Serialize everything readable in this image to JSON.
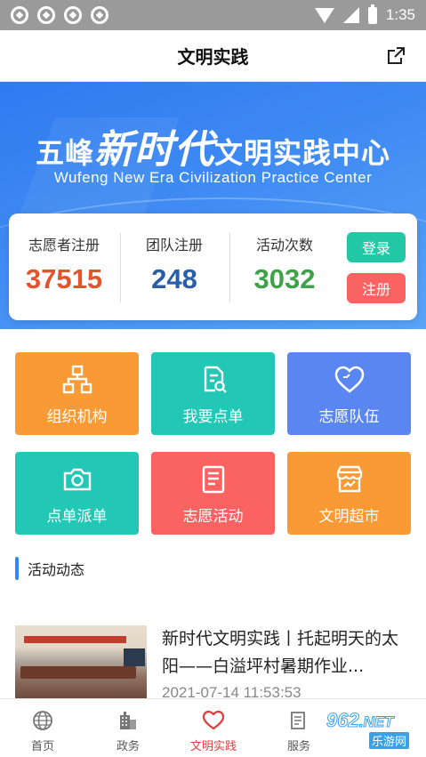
{
  "status_bar": {
    "time": "1:35"
  },
  "header": {
    "title": "文明实践"
  },
  "banner": {
    "title_prefix": "五峰",
    "title_script": "新时代",
    "title_suffix": "文明实践中心",
    "subtitle": "Wufeng New Era Civilization Practice Center"
  },
  "stats": {
    "volunteers": {
      "label": "志愿者注册",
      "value": "37515",
      "color": "#e5532d"
    },
    "teams": {
      "label": "团队注册",
      "value": "248",
      "color": "#2b5ea8"
    },
    "activities": {
      "label": "活动次数",
      "value": "3032",
      "color": "#3fa24a"
    },
    "login_label": "登录",
    "register_label": "注册"
  },
  "tiles": [
    {
      "label": "组织机构",
      "icon": "org-chart-icon",
      "color": "#f99a35"
    },
    {
      "label": "我要点单",
      "icon": "order-search-icon",
      "color": "#22c7b5"
    },
    {
      "label": "志愿队伍",
      "icon": "heart-icon",
      "color": "#5a86f2"
    },
    {
      "label": "点单派单",
      "icon": "camera-icon",
      "color": "#22c7b5"
    },
    {
      "label": "志愿活动",
      "icon": "document-icon",
      "color": "#fb6363"
    },
    {
      "label": "文明超市",
      "icon": "store-icon",
      "color": "#f99a35"
    }
  ],
  "section": {
    "title": "活动动态"
  },
  "news": [
    {
      "title": "新时代文明实践丨托起明天的太阳——白溢坪村暑期作业...",
      "time": "2021-07-14 11:53:53"
    }
  ],
  "bottom_nav": [
    {
      "label": "首页",
      "icon": "globe-icon",
      "active": false
    },
    {
      "label": "政务",
      "icon": "building-icon",
      "active": false
    },
    {
      "label": "文明实践",
      "icon": "heart-icon",
      "active": true
    },
    {
      "label": "服务",
      "icon": "service-icon",
      "active": false
    }
  ],
  "watermark": {
    "text": "962",
    "suffix": ".NET",
    "sub": "乐游网"
  }
}
